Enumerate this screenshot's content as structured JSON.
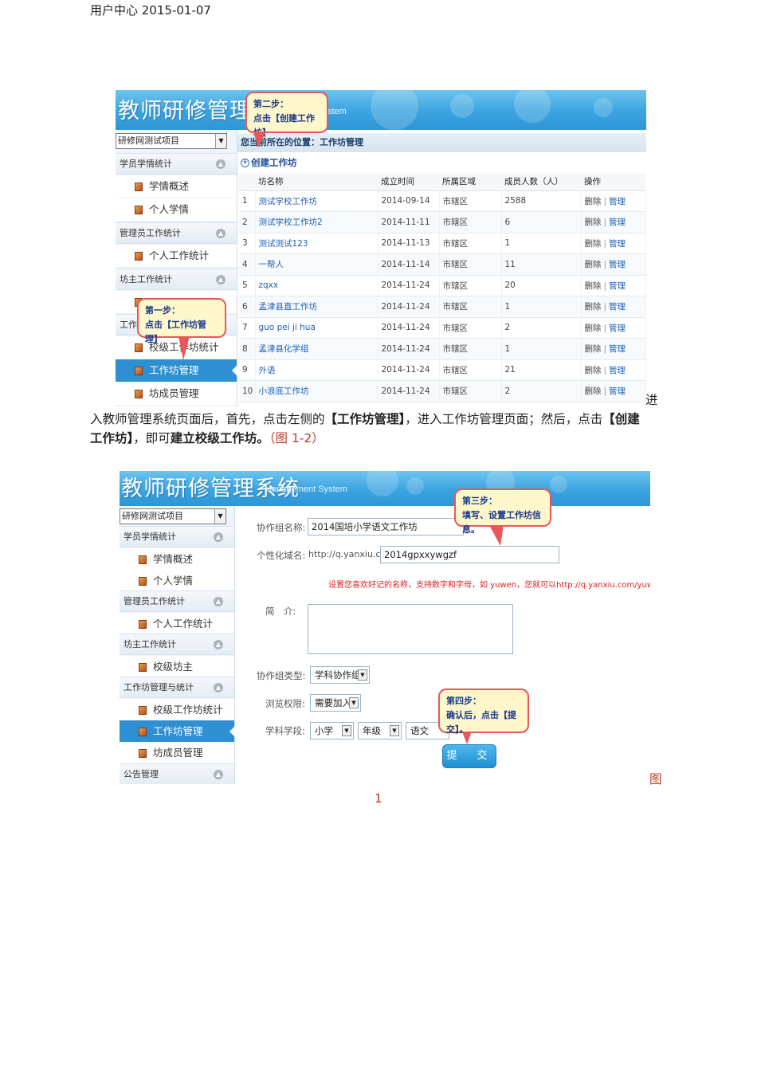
{
  "page_header": "用户中心 2015-01-07",
  "shot1": {
    "banner_title": "教师研修管理系",
    "banner_sub": "stem",
    "project_select": "研修网测试项目",
    "sidebar": {
      "group1": "学员学情统计",
      "item_overview": "学情概述",
      "item_personal": "个人学情",
      "group2": "管理员工作统计",
      "item_personal_work": "个人工作统计",
      "group3": "坊主工作统计",
      "group4_partial": "工作",
      "item_school_stats": "校级工作坊统计",
      "item_ws_manage": "工作坊管理",
      "item_member_manage": "坊成员管理"
    },
    "crumb": "您当前所在的位置：工作坊管理",
    "create_label": "创建工作坊",
    "callout_step2_line1": "第二步：",
    "callout_step2_line2": "点击【创建工作坊】",
    "callout_step1_line1": "第一步：",
    "callout_step1_line2": "点击【工作坊管理】",
    "table": {
      "headers": [
        "",
        "坊名称",
        "成立时间",
        "所属区域",
        "成员人数（人）",
        "操作"
      ],
      "rows": [
        {
          "no": "1",
          "name": "测试学校工作坊",
          "date": "2014-09-14",
          "region": "市辖区",
          "members": "2588"
        },
        {
          "no": "2",
          "name": "测试学校工作坊2",
          "date": "2014-11-11",
          "region": "市辖区",
          "members": "6"
        },
        {
          "no": "3",
          "name": "测试测试123",
          "date": "2014-11-13",
          "region": "市辖区",
          "members": "1"
        },
        {
          "no": "4",
          "name": "一帮人",
          "date": "2014-11-14",
          "region": "市辖区",
          "members": "11"
        },
        {
          "no": "5",
          "name": "zqxx",
          "date": "2014-11-24",
          "region": "市辖区",
          "members": "20"
        },
        {
          "no": "6",
          "name": "孟津县直工作坊",
          "date": "2014-11-24",
          "region": "市辖区",
          "members": "1"
        },
        {
          "no": "7",
          "name": "guo pei ji hua",
          "date": "2014-11-24",
          "region": "市辖区",
          "members": "2"
        },
        {
          "no": "8",
          "name": "孟津县化学组",
          "date": "2014-11-24",
          "region": "市辖区",
          "members": "1"
        },
        {
          "no": "9",
          "name": "外语",
          "date": "2014-11-24",
          "region": "市辖区",
          "members": "21"
        },
        {
          "no": "10",
          "name": "小浪底工作坊",
          "date": "2014-11-24",
          "region": "市辖区",
          "members": "2"
        }
      ],
      "op_delete": "删除",
      "op_sep": "|",
      "op_manage": "管理"
    }
  },
  "paragraph": {
    "p1": "进",
    "p2": "入教师管理系统页面后，首先，点击左侧的",
    "p3": "【工作坊管理】",
    "p4": "，进入工作坊管理页面；然后，点击",
    "p5": "【创建",
    "p6": "工作坊】",
    "p7": "，即可",
    "p8": "建立校级工作坊。",
    "p9": "（图 1-2）"
  },
  "shot2": {
    "banner_title": "教师研修管理系统",
    "banner_sub": "Management System",
    "project_select": "研修网测试项目",
    "sidebar": {
      "group1": "学员学情统计",
      "item_overview": "学情概述",
      "item_personal": "个人学情",
      "group2": "管理员工作统计",
      "item_personal_work": "个人工作统计",
      "group3": "坊主工作统计",
      "item_school_owner": "校级坊主",
      "group4": "工作坊管理与统计",
      "item_school_stats": "校级工作坊统计",
      "item_ws_manage": "工作坊管理",
      "item_member_manage": "坊成员管理",
      "group5": "公告管理"
    },
    "form": {
      "name_label": "协作组名称:",
      "name_value": "2014国培小学语文工作坊",
      "domain_label": "个性化域名:",
      "domain_prefix": "http://q.yanxiu.com/",
      "domain_value": "2014gpxxywgzf",
      "hint": "设置您喜欢好记的名称，支持数字和字母，如 yuwen，您就可以http://q.yanxiu.com/yuwen直接访问。",
      "intro_label": "简　介:",
      "type_label": "协作组类型:",
      "type_value": "学科协作组",
      "perm_label": "浏览权限:",
      "perm_value": "需要加入",
      "subject_label": "学科学段:",
      "stage_value": "小学",
      "grade_value": "年级",
      "subject_value": "语文",
      "submit": "提　交"
    },
    "callout_step3_line1": "第三步：",
    "callout_step3_line2": "填写、设置工作坊信息。",
    "callout_step4_line1": "第四步：",
    "callout_step4_line2": "确认后，点击【提交】。"
  },
  "caption_tu": "图",
  "page_number": "1"
}
